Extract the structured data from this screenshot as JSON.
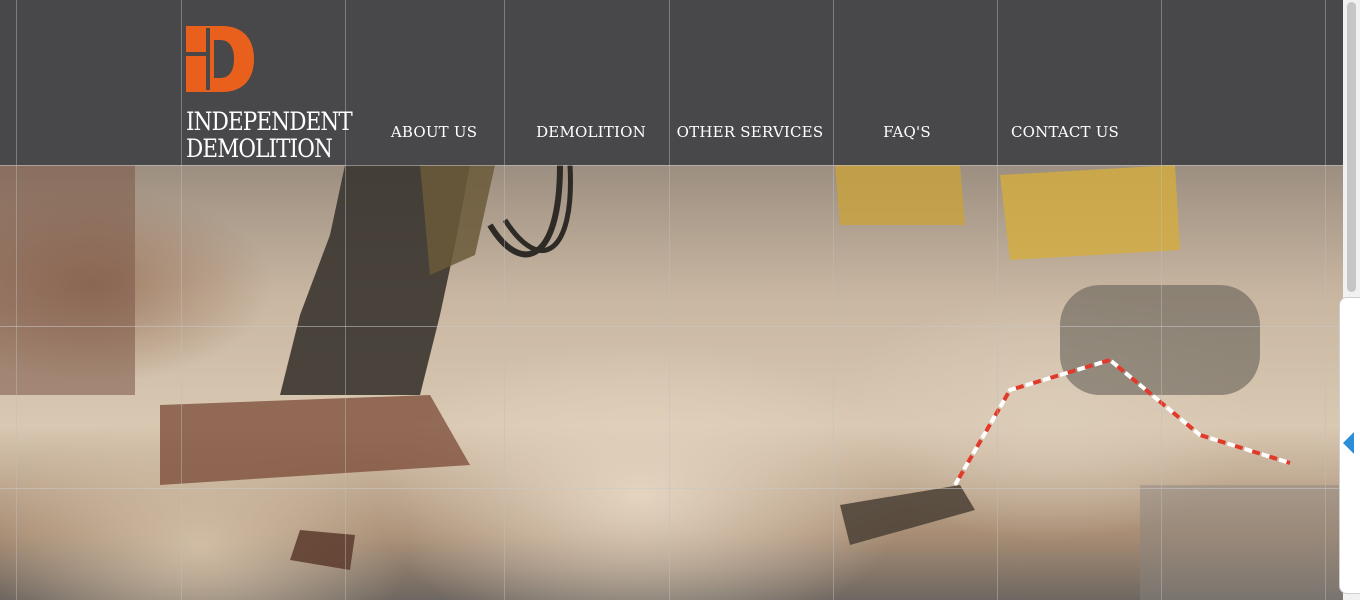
{
  "brand": {
    "logo_icon": "d-logo-icon",
    "line1": "INDEPENDENT",
    "line2": "DEMOLITION",
    "accent_color": "#e8601c"
  },
  "nav": {
    "items": [
      {
        "label": "ABOUT US"
      },
      {
        "label": "DEMOLITION"
      },
      {
        "label": "OTHER SERVICES"
      },
      {
        "label": "FAQ'S"
      },
      {
        "label": "CONTACT US"
      }
    ]
  },
  "colors": {
    "header_bg": "#48484b",
    "nav_text": "#ffffff",
    "side_arrow": "#2a8fd8"
  },
  "side_panel": {
    "toggle_icon": "chevron-left-icon"
  }
}
